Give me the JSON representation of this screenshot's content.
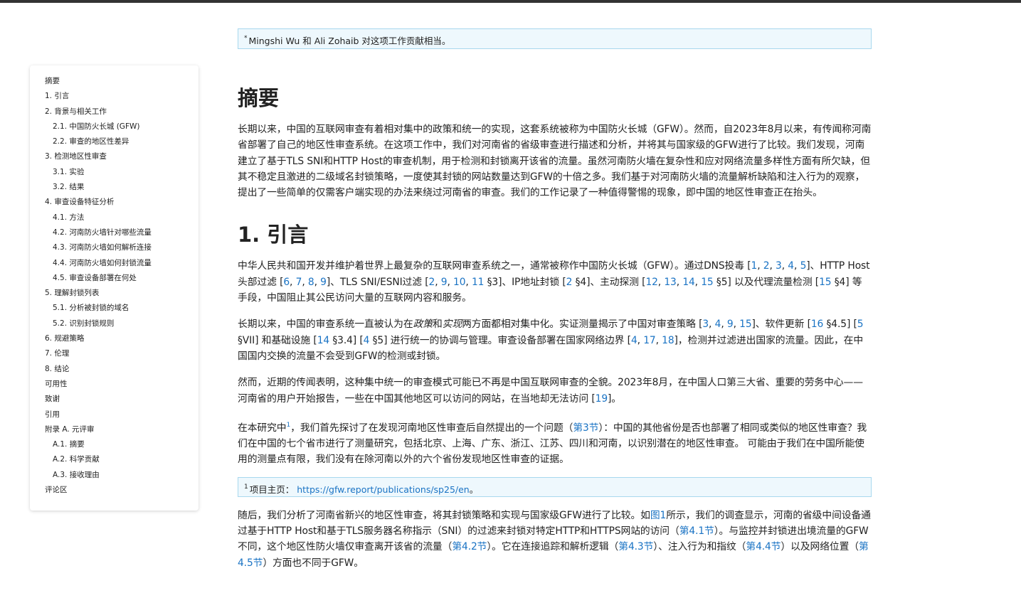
{
  "footnote_star": {
    "marker": "*",
    "text": "Mingshi Wu 和 Ali Zohaib 对这项工作贡献相当。"
  },
  "toc": [
    {
      "label": "摘要",
      "level": 0
    },
    {
      "label": "1. 引言",
      "level": 0
    },
    {
      "label": "2. 背景与相关工作",
      "level": 0
    },
    {
      "label": "2.1. 中国防火长城 (GFW)",
      "level": 1
    },
    {
      "label": "2.2. 审查的地区性差异",
      "level": 1
    },
    {
      "label": "3. 检测地区性审查",
      "level": 0
    },
    {
      "label": "3.1. 实验",
      "level": 1
    },
    {
      "label": "3.2. 结果",
      "level": 1
    },
    {
      "label": "4. 审查设备特征分析",
      "level": 0
    },
    {
      "label": "4.1. 方法",
      "level": 1
    },
    {
      "label": "4.2. 河南防火墙针对哪些流量",
      "level": 1
    },
    {
      "label": "4.3. 河南防火墙如何解析连接",
      "level": 1
    },
    {
      "label": "4.4. 河南防火墙如何封锁流量",
      "level": 1
    },
    {
      "label": "4.5. 审查设备部署在何处",
      "level": 1
    },
    {
      "label": "5. 理解封锁列表",
      "level": 0
    },
    {
      "label": "5.1. 分析被封锁的域名",
      "level": 1
    },
    {
      "label": "5.2. 识别封锁规则",
      "level": 1
    },
    {
      "label": "6. 规避策略",
      "level": 0
    },
    {
      "label": "7. 伦理",
      "level": 0
    },
    {
      "label": "8. 结论",
      "level": 0
    },
    {
      "label": "可用性",
      "level": 0
    },
    {
      "label": "致谢",
      "level": 0
    },
    {
      "label": "引用",
      "level": 0
    },
    {
      "label": "附录 A. 元评审",
      "level": 0
    },
    {
      "label": "A.1. 摘要",
      "level": 1
    },
    {
      "label": "A.2. 科学贡献",
      "level": 1
    },
    {
      "label": "A.3. 接收理由",
      "level": 1
    },
    {
      "label": "评论区",
      "level": 0
    }
  ],
  "abstract": {
    "heading": "摘要",
    "text": "长期以来，中国的互联网审查有着相对集中的政策和统一的实现，这套系统被称为中国防火长城（GFW）。然而，自2023年8月以来，有传闻称河南省部署了自己的地区性审查系统。在这项工作中，我们对河南省的省级审查进行描述和分析，并将其与国家级的GFW进行了比较。我们发现，河南建立了基于TLS SNI和HTTP Host的审查机制，用于检测和封锁离开该省的流量。虽然河南防火墙在复杂性和应对网络流量多样性方面有所欠缺，但其不稳定且激进的二级域名封锁策略，一度使其封锁的网站数量达到GFW的十倍之多。我们基于对河南防火墙的流量解析缺陷和注入行为的观察，提出了一些简单的仅需客户端实现的办法来绕过河南省的审查。我们的工作记录了一种值得警惕的现象，即中国的地区性审查正在抬头。"
  },
  "intro": {
    "heading": "1. 引言",
    "p1": [
      {
        "t": "中华人民共和国开发并维护着世界上最复杂的互联网审查系统之一，通常被称作中国防火长城（GFW）。通过DNS投毒 ["
      },
      {
        "r": "1"
      },
      {
        "t": ", "
      },
      {
        "r": "2"
      },
      {
        "t": ", "
      },
      {
        "r": "3"
      },
      {
        "t": ", "
      },
      {
        "r": "4"
      },
      {
        "t": ", "
      },
      {
        "r": "5"
      },
      {
        "t": "]、HTTP Host头部过滤 ["
      },
      {
        "r": "6"
      },
      {
        "t": ", "
      },
      {
        "r": "7"
      },
      {
        "t": ", "
      },
      {
        "r": "8"
      },
      {
        "t": ", "
      },
      {
        "r": "9"
      },
      {
        "t": "]、TLS SNI/ESNI过滤 ["
      },
      {
        "r": "2"
      },
      {
        "t": ", "
      },
      {
        "r": "9"
      },
      {
        "t": ", "
      },
      {
        "r": "10"
      },
      {
        "t": ", "
      },
      {
        "r": "11"
      },
      {
        "t": " §3]、IP地址封锁 ["
      },
      {
        "r": "2"
      },
      {
        "t": " §4]、主动探测 ["
      },
      {
        "r": "12"
      },
      {
        "t": ", "
      },
      {
        "r": "13"
      },
      {
        "t": ", "
      },
      {
        "r": "14"
      },
      {
        "t": ", "
      },
      {
        "r": "15"
      },
      {
        "t": " §5] 以及代理流量检测 ["
      },
      {
        "r": "15"
      },
      {
        "t": " §4] 等手段，中国阻止其公民访问大量的互联网内容和服务。"
      }
    ],
    "p2": [
      {
        "t": "长期以来，中国的审查系统一直被认为在"
      },
      {
        "e": "政策"
      },
      {
        "t": "和"
      },
      {
        "e": "实现"
      },
      {
        "t": "两方面都相对集中化。实证测量揭示了中国对审查策略 ["
      },
      {
        "r": "3"
      },
      {
        "t": ", "
      },
      {
        "r": "4"
      },
      {
        "t": ", "
      },
      {
        "r": "9"
      },
      {
        "t": ", "
      },
      {
        "r": "15"
      },
      {
        "t": "]、软件更新 ["
      },
      {
        "r": "16"
      },
      {
        "t": " §4.5] ["
      },
      {
        "r": "5"
      },
      {
        "t": " §VII] 和基础设施 ["
      },
      {
        "r": "14"
      },
      {
        "t": " §3.4] ["
      },
      {
        "r": "4"
      },
      {
        "t": " §5] 进行统一的协调与管理。审查设备部署在国家网络边界 ["
      },
      {
        "r": "4"
      },
      {
        "t": ", "
      },
      {
        "r": "17"
      },
      {
        "t": ", "
      },
      {
        "r": "18"
      },
      {
        "t": "]，检测并过滤进出国家的流量。因此，在中国国内交换的流量不会受到GFW的检测或封锁。"
      }
    ],
    "p3": [
      {
        "t": "然而，近期的传闻表明，这种集中统一的审查模式可能已不再是中国互联网审查的全貌。2023年8月，在中国人口第三大省、重要的劳务中心——河南省的用户开始报告，一些在中国其他地区可以访问的网站，在当地却无法访问 ["
      },
      {
        "r": "19"
      },
      {
        "t": "]。"
      }
    ],
    "p4": [
      {
        "t": "在本研究中"
      },
      {
        "s": "1"
      },
      {
        "t": "，我们首先探讨了在发现河南地区性审查后自然提出的一个问题（"
      },
      {
        "r": "第3节"
      },
      {
        "t": "）：中国的其他省份是否也部署了相同或类似的地区性审查？我们在中国的七个省市进行了测量研究，包括北京、上海、广东、浙江、江苏、四川和河南，以识别潜在的地区性审查。 可能由于我们在中国所能使用的测量点有限，我们没有在除河南以外的六个省份发现地区性审查的证据。"
      }
    ],
    "footnote1": {
      "marker": "1",
      "label": "项目主页：",
      "link": "https://gfw.report/publications/sp25/en",
      "trail": "。"
    },
    "p5": [
      {
        "t": "随后，我们分析了河南省新兴的地区性审查，将其封锁策略和实现与国家级GFW进行了比较。如"
      },
      {
        "r": "图1"
      },
      {
        "t": "所示，我们的调查显示，河南的省级中间设备通过基于HTTP Host和基于TLS服务器名称指示（SNI）的过滤来封锁对特定HTTP和HTTPS网站的访问（"
      },
      {
        "r": "第4.1节"
      },
      {
        "t": "）。与监控并封锁进出境流量的GFW不同，这个地区性防火墙仅审查离开该省的流量（"
      },
      {
        "r": "第4.2节"
      },
      {
        "t": "）。它在连接追踪和解析逻辑（"
      },
      {
        "r": "第4.3节"
      },
      {
        "t": "）、注入行为和指纹（"
      },
      {
        "r": "第4.4节"
      },
      {
        "t": "）以及网络位置（"
      },
      {
        "r": "第4.5节"
      },
      {
        "t": "）方面也不同于GFW。"
      }
    ]
  }
}
